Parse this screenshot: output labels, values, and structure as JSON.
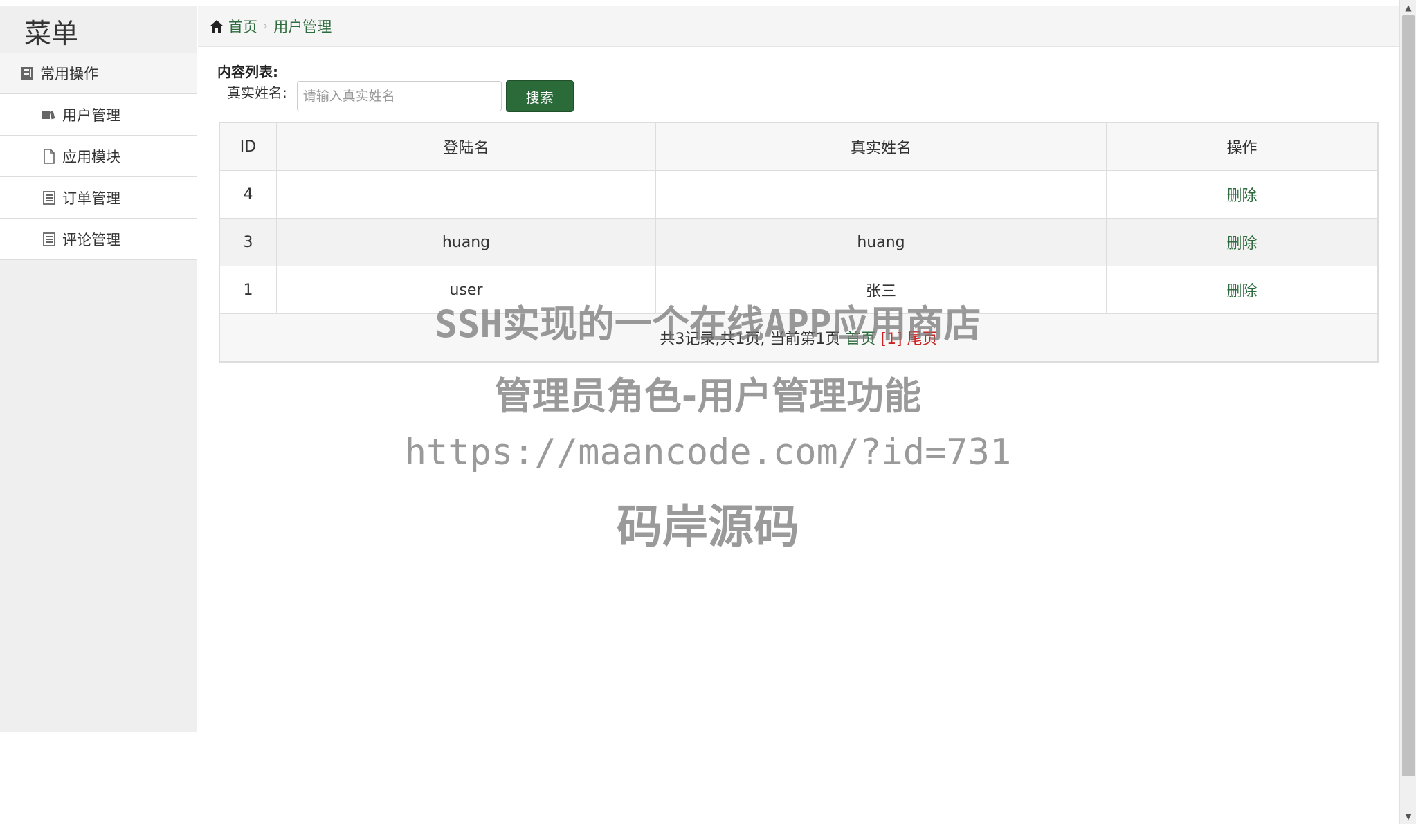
{
  "sidebar": {
    "title": "菜单",
    "group": {
      "label": "常用操作",
      "icon": "book-icon"
    },
    "items": [
      {
        "label": "用户管理",
        "icon": "books-icon"
      },
      {
        "label": "应用模块",
        "icon": "file-icon"
      },
      {
        "label": "订单管理",
        "icon": "list-icon"
      },
      {
        "label": "评论管理",
        "icon": "list-icon"
      }
    ]
  },
  "breadcrumb": {
    "home": "首页",
    "current": "用户管理"
  },
  "content": {
    "list_label": "内容列表:",
    "search": {
      "label": "真实姓名:",
      "placeholder": "请输入真实姓名",
      "value": "",
      "button": "搜索"
    }
  },
  "table": {
    "headers": [
      "ID",
      "登陆名",
      "真实姓名",
      "操作"
    ],
    "rows": [
      {
        "id": "4",
        "login": "",
        "real_name": "",
        "action": "删除"
      },
      {
        "id": "3",
        "login": "huang",
        "real_name": "huang",
        "action": "删除"
      },
      {
        "id": "1",
        "login": "user",
        "real_name": "张三",
        "action": "删除"
      }
    ],
    "pager": {
      "summary": "共3记录,共1页, 当前第1页",
      "first": "首页",
      "current": "[1]",
      "last": "尾页"
    }
  },
  "watermark": {
    "line1": "SSH实现的一个在线APP应用商店",
    "line2": "管理员角色-用户管理功能",
    "line3": "https://maancode.com/?id=731",
    "line4": "码岸源码"
  },
  "colors": {
    "accent": "#2e6b3e",
    "button": "#2a6b39",
    "pager_red": "#cc2222"
  }
}
